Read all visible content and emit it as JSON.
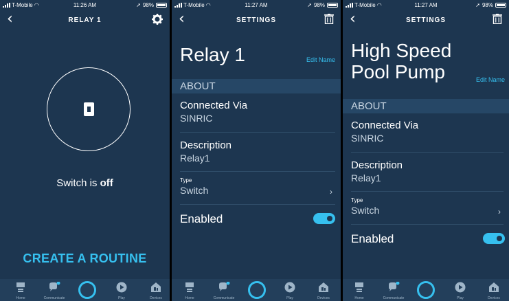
{
  "status_bars": [
    {
      "carrier": "T-Mobile",
      "time": "11:26 AM",
      "battery": "98%"
    },
    {
      "carrier": "T-Mobile",
      "time": "11:27 AM",
      "battery": "98%"
    },
    {
      "carrier": "T-Mobile",
      "time": "11:27 AM",
      "battery": "98%"
    }
  ],
  "screen1": {
    "title": "RELAY 1",
    "switch_text": "Switch is ",
    "switch_state": "off",
    "create_routine": "CREATE A ROUTINE"
  },
  "screen2": {
    "title": "SETTINGS",
    "device_name": "Relay 1",
    "edit_name": "Edit Name",
    "about": "ABOUT",
    "connected_label": "Connected Via",
    "connected_value": "SINRIC",
    "description_label": "Description",
    "description_value": "Relay1",
    "type_label": "Type",
    "type_value": "Switch",
    "enabled_label": "Enabled",
    "enabled": true
  },
  "screen3": {
    "title": "SETTINGS",
    "device_name_line1": "High Speed",
    "device_name_line2": "Pool Pump",
    "edit_name": "Edit Name",
    "about": "ABOUT",
    "connected_label": "Connected Via",
    "connected_value": "SINRIC",
    "description_label": "Description",
    "description_value": "Relay1",
    "type_label": "Type",
    "type_value": "Switch",
    "enabled_label": "Enabled",
    "enabled": true
  },
  "bottom_nav": {
    "home": "Home",
    "communicate": "Communicate",
    "play": "Play",
    "devices": "Devices"
  },
  "colors": {
    "background": "#1d3650",
    "accent": "#36c0ef",
    "about_bar": "#264766"
  }
}
